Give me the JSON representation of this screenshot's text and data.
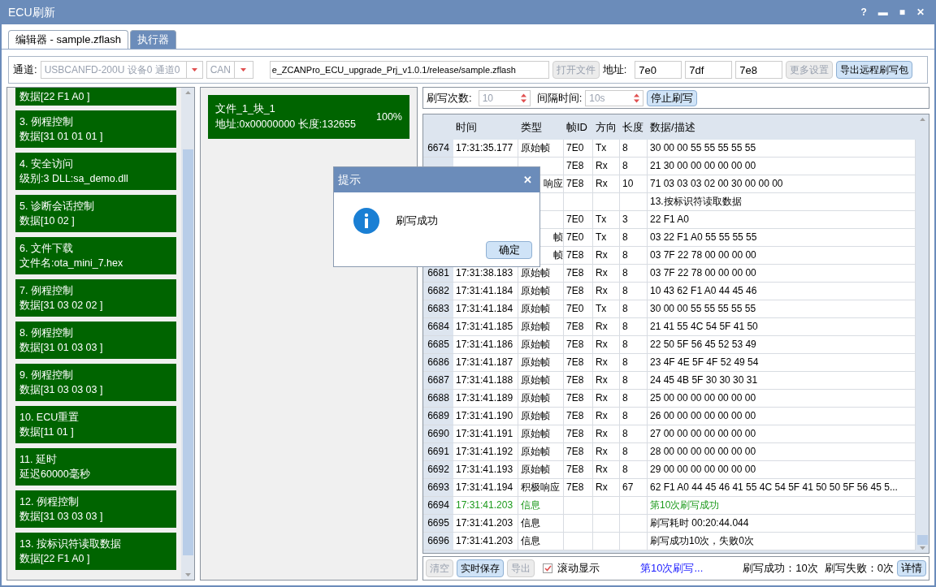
{
  "window": {
    "title": "ECU刷新",
    "controls": [
      "?",
      "▬",
      "■",
      "✕"
    ]
  },
  "tabs": [
    {
      "label": "编辑器 - sample.zflash",
      "selected": false
    },
    {
      "label": "执行器",
      "selected": true
    }
  ],
  "toolbar": {
    "channel_label": "通道:",
    "channel": {
      "value": "USBCANFD-200U 设备0 通道0",
      "disabled": true
    },
    "protocol": {
      "value": "CAN",
      "disabled": true
    },
    "file_path": "e_ZCANPro_ECU_upgrade_Prj_v1.0.1/release/sample.zflash",
    "open_button": {
      "label": "打开文件",
      "disabled": true
    },
    "address_label": "地址:",
    "addresses": [
      "7e0",
      "7df",
      "7e8"
    ],
    "more_button": {
      "label": "更多设置",
      "disabled": true
    },
    "export_button": {
      "label": "导出远程刷写包",
      "disabled": false
    }
  },
  "steps": [
    {
      "detail": "数据[22 F1 A0 ]"
    },
    {
      "title": "3. 例程控制",
      "detail": "数据[31 01 01 01 ]"
    },
    {
      "title": "4. 安全访问",
      "detail": "级别:3 DLL:sa_demo.dll"
    },
    {
      "title": "5. 诊断会话控制",
      "detail": "数据[10 02 ]"
    },
    {
      "title": "6. 文件下载",
      "detail": "文件名:ota_mini_7.hex"
    },
    {
      "title": "7. 例程控制",
      "detail": "数据[31 03 02 02 ]"
    },
    {
      "title": "8. 例程控制",
      "detail": "数据[31 01 03 03 ]"
    },
    {
      "title": "9. 例程控制",
      "detail": "数据[31 03 03 03 ]"
    },
    {
      "title": "10. ECU重置",
      "detail": "数据[11 01 ]"
    },
    {
      "title": "11. 延时",
      "detail": "延迟60000毫秒"
    },
    {
      "title": "12. 例程控制",
      "detail": "数据[31 03 03 03 ]"
    },
    {
      "title": "13. 按标识符读取数据",
      "detail": "数据[22 F1 A0 ]"
    }
  ],
  "blocks": [
    {
      "name": "文件_1_块_1",
      "info": "地址:0x00000000 长度:132655",
      "percent": "100%"
    }
  ],
  "controls": {
    "count_label": "刷写次数:",
    "count": {
      "value": "10",
      "disabled": true
    },
    "interval_label": "间隔时间:",
    "interval": {
      "value": "10s",
      "disabled": true
    },
    "stop_button": "停止刷写"
  },
  "table": {
    "columns": [
      "时间",
      "类型",
      "帧ID",
      "方向",
      "长度",
      "数据/描述"
    ],
    "rows": [
      {
        "kind": "normal",
        "no": "6674",
        "time": "17:31:35.177",
        "type": "原始帧",
        "id": "7E0",
        "dir": "Tx",
        "len": "8",
        "data": "30 00 00 55 55 55 55 55"
      },
      {
        "kind": "partial",
        "no": "",
        "time": "",
        "type": "",
        "id": "7E8",
        "dir": "Rx",
        "len": "8",
        "data": "21 30 00 00 00 00 00 00"
      },
      {
        "kind": "partial",
        "no": "",
        "time": "",
        "type": "响应",
        "id": "7E8",
        "dir": "Rx",
        "len": "10",
        "data": "71 03 03 03 02 00 30 00 00 00"
      },
      {
        "kind": "partial",
        "no": "",
        "time": "",
        "type": "",
        "id": "",
        "dir": "",
        "len": "",
        "data": "13.按标识符读取数据"
      },
      {
        "kind": "partial",
        "no": "",
        "time": "",
        "type": "",
        "id": "7E0",
        "dir": "Tx",
        "len": "3",
        "data": "22 F1 A0"
      },
      {
        "kind": "partial",
        "no": "",
        "time": "",
        "type": "帧",
        "id": "7E0",
        "dir": "Tx",
        "len": "8",
        "data": "03 22 F1 A0 55 55 55 55"
      },
      {
        "kind": "partial",
        "no": "",
        "time": "",
        "type": "帧",
        "id": "7E8",
        "dir": "Rx",
        "len": "8",
        "data": "03 7F 22 78 00 00 00 00"
      },
      {
        "kind": "normal",
        "no": "6681",
        "time": "17:31:38.183",
        "type": "原始帧",
        "id": "7E8",
        "dir": "Rx",
        "len": "8",
        "data": "03 7F 22 78 00 00 00 00"
      },
      {
        "kind": "normal",
        "no": "6682",
        "time": "17:31:41.184",
        "type": "原始帧",
        "id": "7E8",
        "dir": "Rx",
        "len": "8",
        "data": "10 43 62 F1 A0 44 45 46"
      },
      {
        "kind": "normal",
        "no": "6683",
        "time": "17:31:41.184",
        "type": "原始帧",
        "id": "7E0",
        "dir": "Tx",
        "len": "8",
        "data": "30 00 00 55 55 55 55 55"
      },
      {
        "kind": "normal",
        "no": "6684",
        "time": "17:31:41.185",
        "type": "原始帧",
        "id": "7E8",
        "dir": "Rx",
        "len": "8",
        "data": "21 41 55 4C 54 5F 41 50"
      },
      {
        "kind": "normal",
        "no": "6685",
        "time": "17:31:41.186",
        "type": "原始帧",
        "id": "7E8",
        "dir": "Rx",
        "len": "8",
        "data": "22 50 5F 56 45 52 53 49"
      },
      {
        "kind": "normal",
        "no": "6686",
        "time": "17:31:41.187",
        "type": "原始帧",
        "id": "7E8",
        "dir": "Rx",
        "len": "8",
        "data": "23 4F 4E 5F 4F 52 49 54"
      },
      {
        "kind": "normal",
        "no": "6687",
        "time": "17:31:41.188",
        "type": "原始帧",
        "id": "7E8",
        "dir": "Rx",
        "len": "8",
        "data": "24 45 4B 5F 30 30 30 31"
      },
      {
        "kind": "normal",
        "no": "6688",
        "time": "17:31:41.189",
        "type": "原始帧",
        "id": "7E8",
        "dir": "Rx",
        "len": "8",
        "data": "25 00 00 00 00 00 00 00"
      },
      {
        "kind": "normal",
        "no": "6689",
        "time": "17:31:41.190",
        "type": "原始帧",
        "id": "7E8",
        "dir": "Rx",
        "len": "8",
        "data": "26 00 00 00 00 00 00 00"
      },
      {
        "kind": "normal",
        "no": "6690",
        "time": "17:31:41.191",
        "type": "原始帧",
        "id": "7E8",
        "dir": "Rx",
        "len": "8",
        "data": "27 00 00 00 00 00 00 00"
      },
      {
        "kind": "normal",
        "no": "6691",
        "time": "17:31:41.192",
        "type": "原始帧",
        "id": "7E8",
        "dir": "Rx",
        "len": "8",
        "data": "28 00 00 00 00 00 00 00"
      },
      {
        "kind": "normal",
        "no": "6692",
        "time": "17:31:41.193",
        "type": "原始帧",
        "id": "7E8",
        "dir": "Rx",
        "len": "8",
        "data": "29 00 00 00 00 00 00 00"
      },
      {
        "kind": "normal",
        "no": "6693",
        "time": "17:31:41.194",
        "type": "积极响应",
        "id": "7E8",
        "dir": "Rx",
        "len": "67",
        "data": "62 F1 A0 44 45 46 41 55 4C 54 5F 41 50 50 5F 56 45 5..."
      },
      {
        "kind": "success",
        "no": "6694",
        "time": "17:31:41.203",
        "type": "信息",
        "id": "",
        "dir": "",
        "len": "",
        "data": "第10次刷写成功"
      },
      {
        "kind": "normal",
        "no": "6695",
        "time": "17:31:41.203",
        "type": "信息",
        "id": "",
        "dir": "",
        "len": "",
        "data": "刷写耗时 00:20:44.044"
      },
      {
        "kind": "normal",
        "no": "6696",
        "time": "17:31:41.203",
        "type": "信息",
        "id": "",
        "dir": "",
        "len": "",
        "data": "刷写成功10次，失败0次"
      }
    ]
  },
  "bottom": {
    "clear": {
      "label": "清空",
      "disabled": true
    },
    "save": {
      "label": "实时保存",
      "disabled": false
    },
    "export": {
      "label": "导出",
      "disabled": true
    },
    "scroll": {
      "label": "滚动显示",
      "checked": true
    },
    "progress": "第10次刷写...",
    "success": "刷写成功：10次",
    "fail": "刷写失败：0次",
    "details": "详情"
  },
  "dialog": {
    "title": "提示",
    "close": "✕",
    "message": "刷写成功",
    "ok": "确定"
  }
}
